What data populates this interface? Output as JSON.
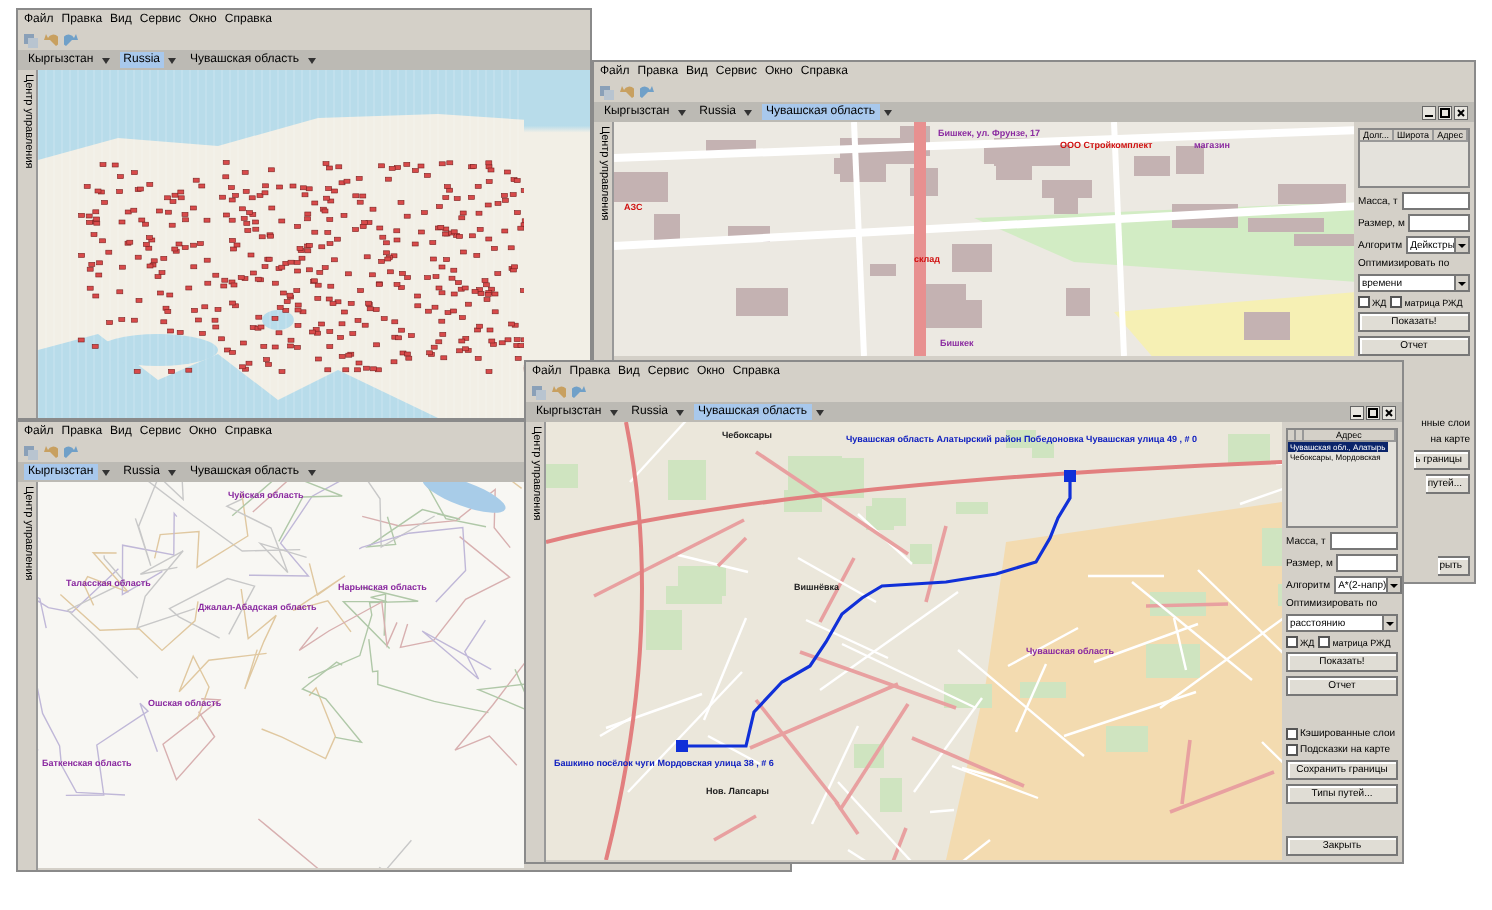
{
  "windows": [
    {
      "kind": "world",
      "menu": [
        "Файл",
        "Правка",
        "Вид",
        "Сервис",
        "Окно",
        "Справка"
      ],
      "breadcrumb": [
        {
          "label": "Кыргызстан",
          "selected": false
        },
        {
          "label": "Russia",
          "selected": true
        },
        {
          "label": "Чувашская область",
          "selected": false
        }
      ],
      "side_tab": "Центр управления"
    },
    {
      "kind": "region",
      "menu": [
        "Файл",
        "Правка",
        "Вид",
        "Сервис",
        "Окно",
        "Справка"
      ],
      "breadcrumb": [
        {
          "label": "Кыргызстан",
          "selected": true
        },
        {
          "label": "Russia",
          "selected": false
        },
        {
          "label": "Чувашская область",
          "selected": false
        }
      ],
      "side_tab": "Центр управления",
      "labels": [
        {
          "text": "Чуйская область",
          "color": "#8a2aa0"
        },
        {
          "text": "Таласская область",
          "color": "#8a2aa0"
        },
        {
          "text": "Джалал-Абадская область",
          "color": "#8a2aa0"
        },
        {
          "text": "Нарынская область",
          "color": "#8a2aa0"
        },
        {
          "text": "Ошская область",
          "color": "#8a2aa0"
        },
        {
          "text": "Баткенская область",
          "color": "#8a2aa0"
        }
      ]
    },
    {
      "kind": "city",
      "menu": [
        "Файл",
        "Правка",
        "Вид",
        "Сервис",
        "Окно",
        "Справка"
      ],
      "breadcrumb": [
        {
          "label": "Кыргызстан",
          "selected": false
        },
        {
          "label": "Russia",
          "selected": false
        },
        {
          "label": "Чувашская область",
          "selected": true
        }
      ],
      "side_tab": "Центр управления",
      "window_controls": true,
      "labels": [
        {
          "text": "Бишкек, ул. Фрунзе, 17",
          "color": "#8a2aa0"
        },
        {
          "text": "ООО Стройкомплект",
          "color": "#d01010"
        },
        {
          "text": "магазин",
          "color": "#8a2aa0"
        },
        {
          "text": "Бишкек",
          "color": "#8a2aa0"
        },
        {
          "text": "склад",
          "color": "#d01010"
        },
        {
          "text": "АЗС",
          "color": "#d01010"
        }
      ],
      "panel": [
        {
          "kind": "table",
          "columns": [
            "Долг...",
            "Широта",
            "Адрес"
          ]
        },
        {
          "kind": "field",
          "label": "Масса, т"
        },
        {
          "kind": "field",
          "label": "Размер, м"
        },
        {
          "kind": "select",
          "label": "Алгоритм",
          "value": "Дейкстры"
        },
        {
          "kind": "select_block",
          "label": "Оптимизировать по",
          "value": "времени"
        },
        {
          "kind": "checks",
          "items": [
            {
              "label": "ЖД",
              "checked": false
            },
            {
              "label": "матрица РЖД",
              "checked": false
            }
          ]
        },
        {
          "kind": "button",
          "label": "Показать!"
        },
        {
          "kind": "button",
          "label": "Отчет"
        },
        {
          "kind": "gap"
        },
        {
          "kind": "cut",
          "label": "нные слои"
        },
        {
          "kind": "cut",
          "label": "на карте"
        },
        {
          "kind": "cut_button",
          "label": "ь границы"
        },
        {
          "kind": "cut_button",
          "label": "путей..."
        },
        {
          "kind": "gap"
        },
        {
          "kind": "cut_button",
          "label": "рыть"
        }
      ]
    },
    {
      "kind": "route",
      "menu": [
        "Файл",
        "Правка",
        "Вид",
        "Сервис",
        "Окно",
        "Справка"
      ],
      "breadcrumb": [
        {
          "label": "Кыргызстан",
          "selected": false
        },
        {
          "label": "Russia",
          "selected": false
        },
        {
          "label": "Чувашская область",
          "selected": true
        }
      ],
      "side_tab": "Центр управления",
      "window_controls": true,
      "labels": [
        {
          "text": "Чувашская область Алатырский район Победоновка Чувашская улица 49 , # 0",
          "color": "#1020c0"
        },
        {
          "text": "Чебоксары",
          "color": "#202020"
        },
        {
          "text": "Вишнёвка",
          "color": "#202020"
        },
        {
          "text": "Чувашская область",
          "color": "#8a2aa0"
        },
        {
          "text": "Башкино посёлок чуги Мордовская улица 38 , # 6",
          "color": "#1020c0"
        },
        {
          "text": "Нов. Лапсары",
          "color": "#202020"
        }
      ],
      "panel": [
        {
          "kind": "table",
          "columns": [
            "Адрес"
          ],
          "rows": [
            {
              "cells": [
                "Чувашская обл., Алатырь"
              ],
              "selected": true
            },
            {
              "cells": [
                "Чебоксары, Мордовская"
              ],
              "selected": false
            }
          ]
        },
        {
          "kind": "field",
          "label": "Масса, т"
        },
        {
          "kind": "field",
          "label": "Размер, м"
        },
        {
          "kind": "select",
          "label": "Алгоритм",
          "value": "A*(2-напр)"
        },
        {
          "kind": "select_block",
          "label": "Оптимизировать по",
          "value": "расстоянию"
        },
        {
          "kind": "checks",
          "items": [
            {
              "label": "ЖД",
              "checked": false
            },
            {
              "label": "матрица РЖД",
              "checked": false
            }
          ]
        },
        {
          "kind": "button",
          "label": "Показать!"
        },
        {
          "kind": "button",
          "label": "Отчет"
        },
        {
          "kind": "gap"
        },
        {
          "kind": "checkbox",
          "label": "Кэшированные слои",
          "checked": false
        },
        {
          "kind": "checkbox",
          "label": "Подсказки на карте",
          "checked": false
        },
        {
          "kind": "button",
          "label": "Сохранить границы"
        },
        {
          "kind": "button",
          "label": "Типы путей..."
        },
        {
          "kind": "gap"
        },
        {
          "kind": "button",
          "label": "Закрыть"
        }
      ]
    }
  ]
}
